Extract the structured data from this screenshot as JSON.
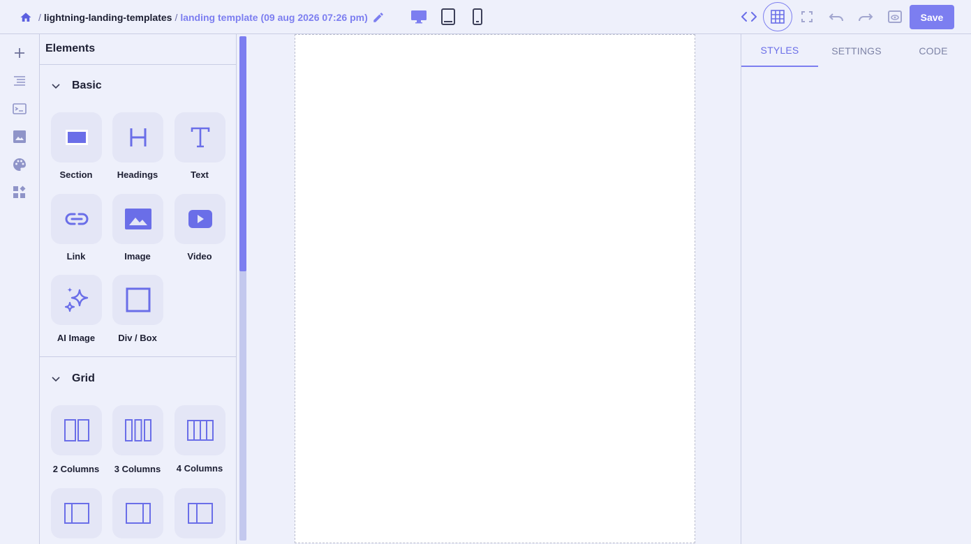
{
  "breadcrumb": {
    "project": "lightning-landing-templates",
    "separator": "/",
    "template": "landing template (09 aug 2026 07:26 pm)"
  },
  "devices": [
    "desktop-icon",
    "tablet-icon",
    "mobile-icon"
  ],
  "toolbar": {
    "save_label": "Save",
    "icons": [
      "code-icon",
      "grid-icon",
      "fullscreen-icon",
      "undo-icon",
      "redo-icon",
      "preview-icon"
    ]
  },
  "rail": {
    "icons": [
      "plus-icon",
      "layers-icon",
      "terminal-icon",
      "image-icon",
      "palette-icon",
      "widgets-icon"
    ]
  },
  "elements_panel": {
    "title": "Elements",
    "groups": [
      {
        "title": "Basic",
        "items": [
          {
            "label": "Section",
            "icon": "section-icon"
          },
          {
            "label": "Headings",
            "icon": "heading-icon"
          },
          {
            "label": "Text",
            "icon": "text-icon"
          },
          {
            "label": "Link",
            "icon": "link-icon"
          },
          {
            "label": "Image",
            "icon": "image-icon"
          },
          {
            "label": "Video",
            "icon": "video-icon"
          },
          {
            "label": "AI Image",
            "icon": "sparkle-icon"
          },
          {
            "label": "Div / Box",
            "icon": "box-icon"
          }
        ]
      },
      {
        "title": "Grid",
        "items": [
          {
            "label": "2 Columns",
            "icon": "two-columns-icon"
          },
          {
            "label": "3 Columns",
            "icon": "three-columns-icon"
          },
          {
            "label": "4 Columns",
            "icon": "four-columns-icon"
          },
          {
            "label": "",
            "icon": "columns-left-narrow-icon"
          },
          {
            "label": "",
            "icon": "columns-right-narrow-icon"
          },
          {
            "label": "",
            "icon": "columns-left-narrow-alt-icon"
          }
        ]
      }
    ]
  },
  "right_panel": {
    "tabs": [
      {
        "label": "STYLES",
        "active": true
      },
      {
        "label": "SETTINGS",
        "active": false
      },
      {
        "label": "CODE",
        "active": false
      }
    ]
  },
  "colors": {
    "accent": "#7c7ef0",
    "background": "#eef0fb",
    "tile": "#e4e6f6",
    "text": "#1d1f33"
  }
}
